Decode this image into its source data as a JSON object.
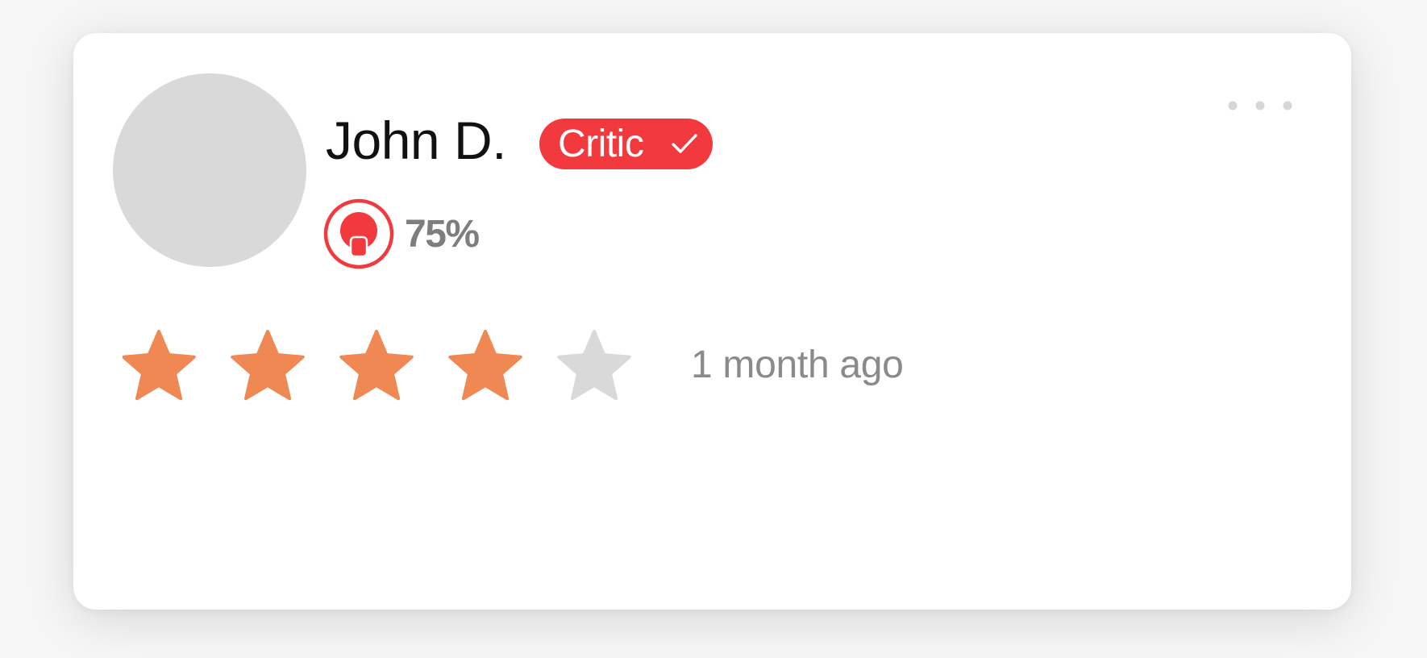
{
  "review": {
    "reviewer_name": "John D.",
    "badge_label": "Critic",
    "score": "75%",
    "rating": {
      "value": 4,
      "max": 5
    },
    "time_ago": "1 month ago"
  },
  "icons": {
    "badge": "check-icon",
    "score": "critic-score-icon",
    "menu": "more-options-icon",
    "rating": "star-icon"
  },
  "colors": {
    "accent": "#f23a3e",
    "star_filled": "#ef8852",
    "star_empty": "#d9d9d9",
    "avatar_placeholder": "#d9d9d9",
    "muted_text": "#8a8a8a"
  }
}
